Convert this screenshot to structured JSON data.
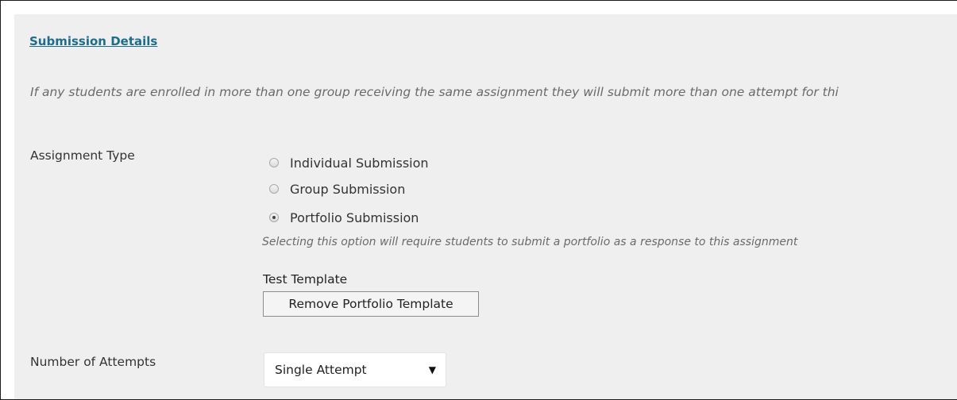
{
  "section": {
    "heading": "Submission Details",
    "note": "If any students are enrolled in more than one group receiving the same assignment they will submit more than one attempt for thi"
  },
  "assignment_type": {
    "label": "Assignment Type",
    "options": [
      {
        "label": "Individual Submission",
        "checked": false
      },
      {
        "label": "Group Submission",
        "checked": false
      },
      {
        "label": "Portfolio Submission",
        "checked": true
      }
    ],
    "portfolio_hint": "Selecting this option will require students to submit a portfolio as a response to this assignment",
    "template_name": "Test Template",
    "remove_button": "Remove Portfolio Template"
  },
  "attempts": {
    "label": "Number of Attempts",
    "selected": "Single Attempt",
    "caret_icon": "caret-down-icon"
  }
}
